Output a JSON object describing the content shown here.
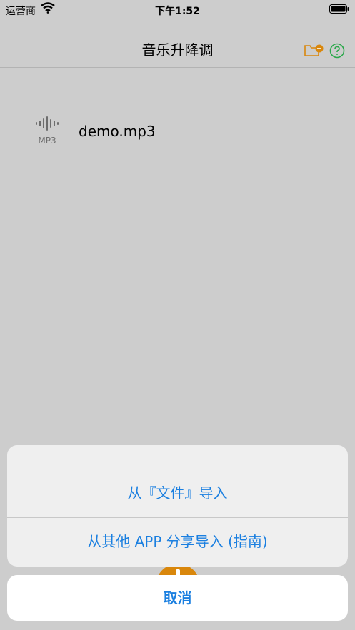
{
  "status_bar": {
    "carrier": "运营商",
    "time": "下午1:52",
    "wifi_icon": "wifi-icon",
    "battery_icon": "battery-icon"
  },
  "nav": {
    "title": "音乐升降调",
    "folder_icon": "folder-minus-icon",
    "help_icon": "question-circle-icon",
    "accent_color": "#d9870c",
    "help_color": "#2aa84a"
  },
  "files": [
    {
      "icon": "audio-waveform-icon",
      "ext": "MP3",
      "name": "demo.mp3"
    }
  ],
  "action_sheet": {
    "options": [
      "从『文件』导入",
      "从其他 APP 分享导入 (指南)"
    ],
    "cancel": "取消",
    "tint_color": "#1a7fe0"
  }
}
